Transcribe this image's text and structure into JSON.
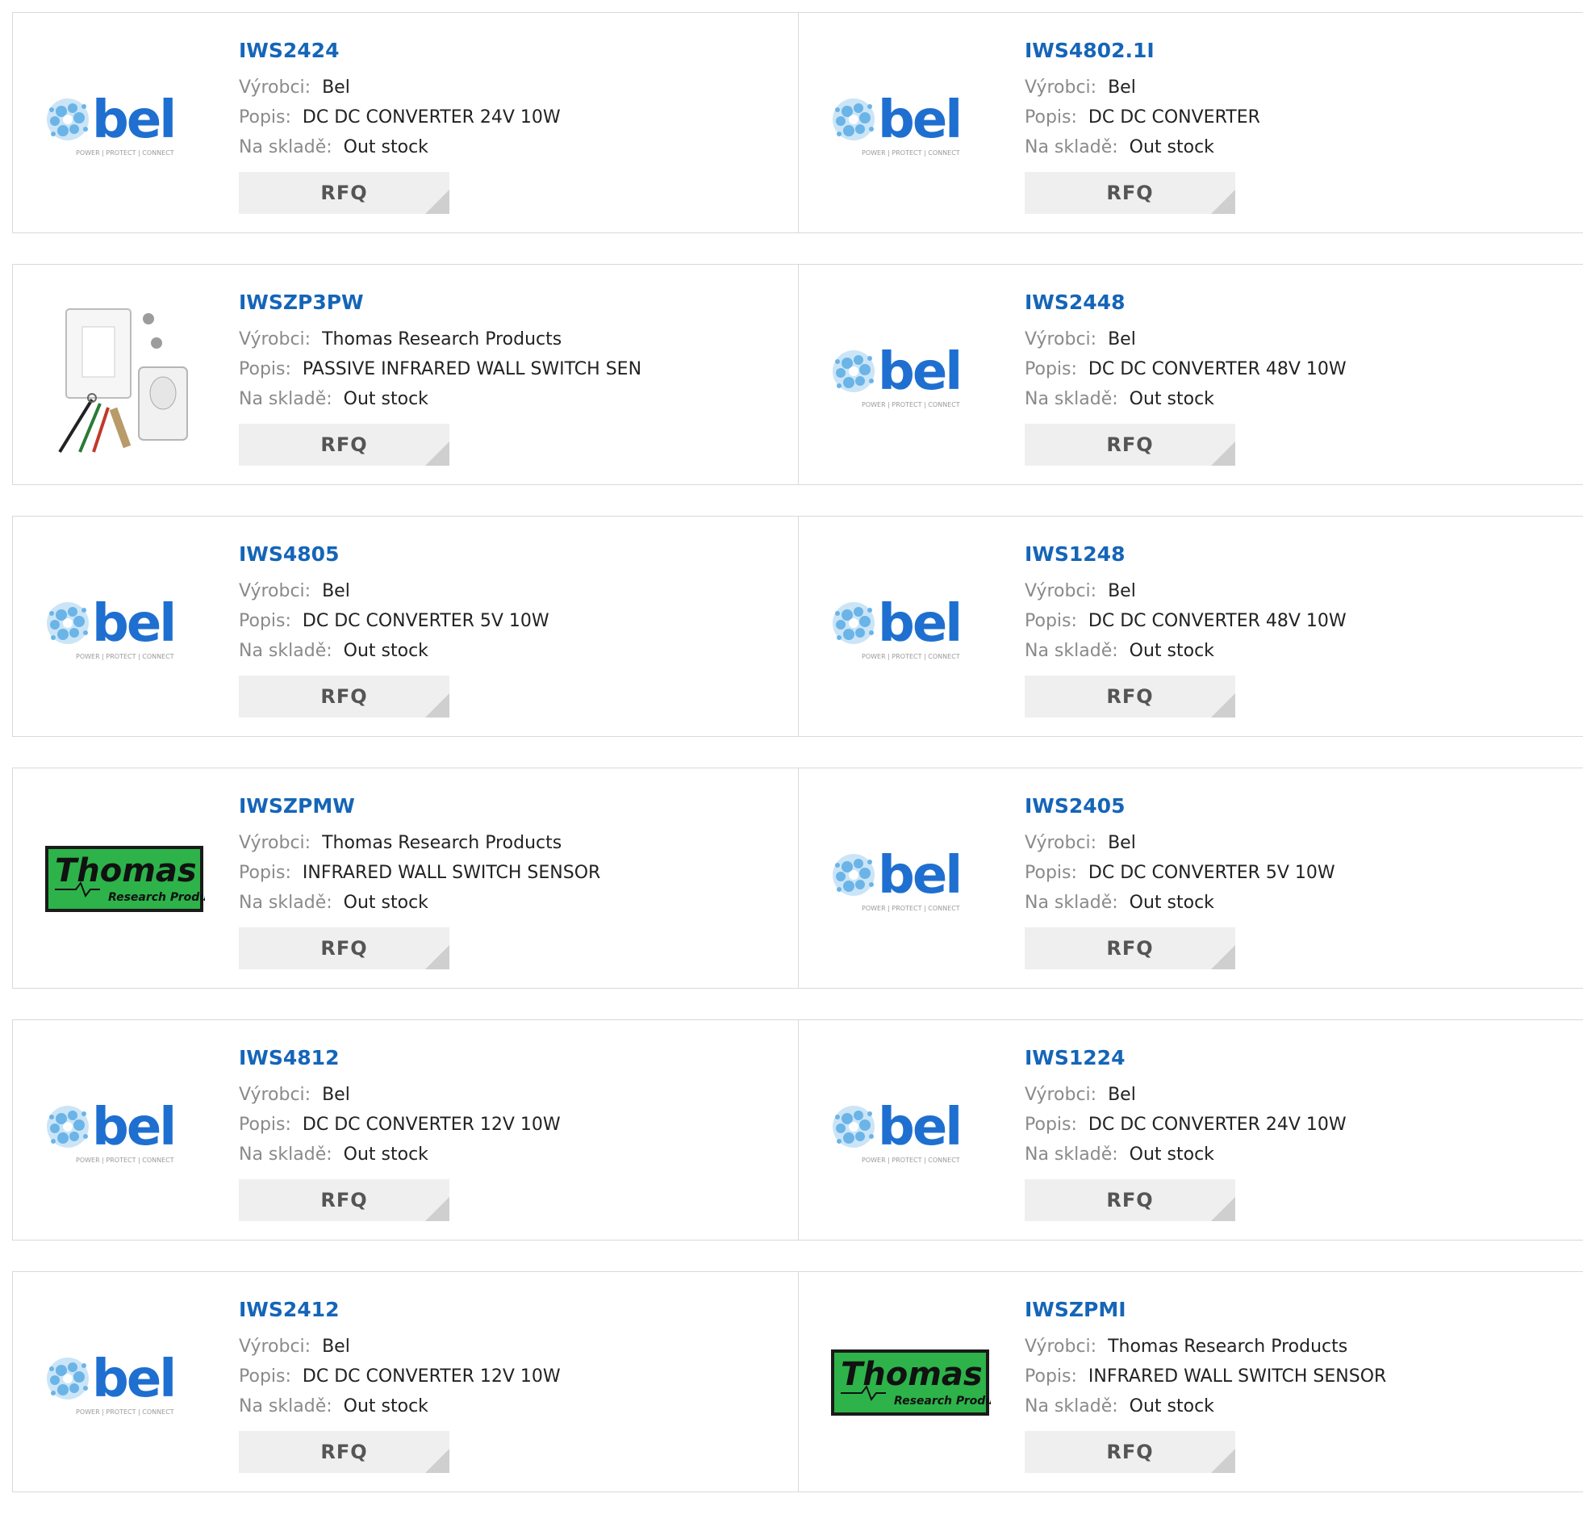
{
  "labels": {
    "manufacturer": "Výrobci:",
    "description": "Popis:",
    "stock": "Na skladě:"
  },
  "rows": [
    [
      {
        "part": "IWS2424",
        "logo": "bel",
        "manufacturer": "Bel",
        "description": "DC DC CONVERTER 24V 10W",
        "stock": "Out stock",
        "button": "RFQ"
      },
      {
        "part": "IWS4802.1I",
        "logo": "bel",
        "manufacturer": "Bel",
        "description": "DC DC CONVERTER",
        "stock": "Out stock",
        "button": "RFQ"
      }
    ],
    [
      {
        "part": "IWSZP3PW",
        "logo": "wall-switch-photo",
        "manufacturer": "Thomas Research Products",
        "description": "PASSIVE INFRARED WALL SWITCH SEN",
        "stock": "Out stock",
        "button": "RFQ"
      },
      {
        "part": "IWS2448",
        "logo": "bel",
        "manufacturer": "Bel",
        "description": "DC DC CONVERTER 48V 10W",
        "stock": "Out stock",
        "button": "RFQ"
      }
    ],
    [
      {
        "part": "IWS4805",
        "logo": "bel",
        "manufacturer": "Bel",
        "description": "DC DC CONVERTER 5V 10W",
        "stock": "Out stock",
        "button": "RFQ"
      },
      {
        "part": "IWS1248",
        "logo": "bel",
        "manufacturer": "Bel",
        "description": "DC DC CONVERTER 48V 10W",
        "stock": "Out stock",
        "button": "RFQ"
      }
    ],
    [
      {
        "part": "IWSZPMW",
        "logo": "thomas",
        "manufacturer": "Thomas Research Products",
        "description": "INFRARED WALL SWITCH SENSOR",
        "stock": "Out stock",
        "button": "RFQ"
      },
      {
        "part": "IWS2405",
        "logo": "bel",
        "manufacturer": "Bel",
        "description": "DC DC CONVERTER 5V 10W",
        "stock": "Out stock",
        "button": "RFQ"
      }
    ],
    [
      {
        "part": "IWS4812",
        "logo": "bel",
        "manufacturer": "Bel",
        "description": "DC DC CONVERTER 12V 10W",
        "stock": "Out stock",
        "button": "RFQ"
      },
      {
        "part": "IWS1224",
        "logo": "bel",
        "manufacturer": "Bel",
        "description": "DC DC CONVERTER 24V 10W",
        "stock": "Out stock",
        "button": "RFQ"
      }
    ],
    [
      {
        "part": "IWS2412",
        "logo": "bel",
        "manufacturer": "Bel",
        "description": "DC DC CONVERTER 12V 10W",
        "stock": "Out stock",
        "button": "RFQ"
      },
      {
        "part": "IWSZPMI",
        "logo": "thomas",
        "manufacturer": "Thomas Research Products",
        "description": "INFRARED WALL SWITCH SENSOR",
        "stock": "Out stock",
        "button": "RFQ"
      }
    ]
  ],
  "logo_text": {
    "bel": {
      "wordmark": "bel",
      "tagline": "POWER | PROTECT | CONNECT"
    },
    "thomas": {
      "wordmark": "Thomas",
      "tagline": "Research Products"
    }
  },
  "colors": {
    "part_link": "#1565b8",
    "bel_blue": "#1e6fd0",
    "bel_light": "#6bb4e8",
    "thomas_green": "#2db34a",
    "button_bg": "#efefef"
  }
}
